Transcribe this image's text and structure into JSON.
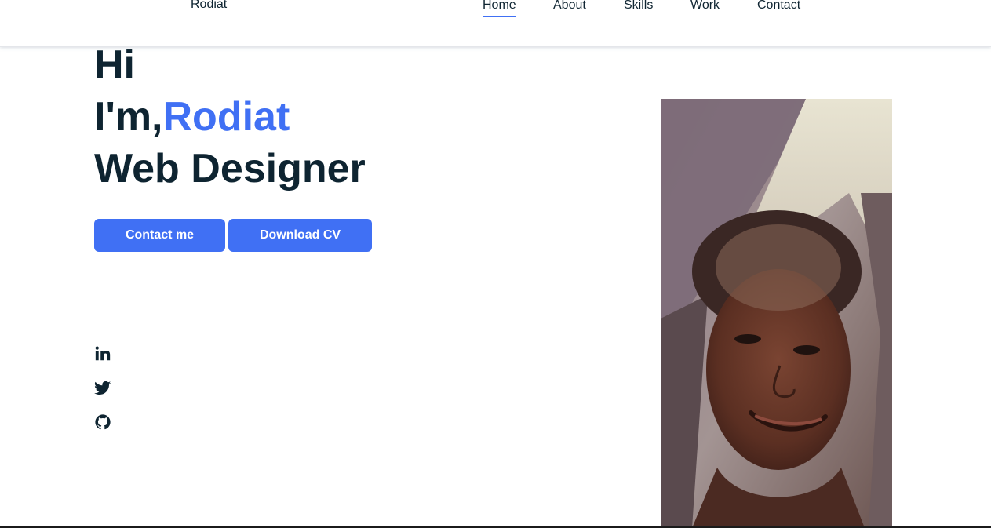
{
  "header": {
    "logo": "Rodiat",
    "nav": [
      {
        "label": "Home",
        "active": true
      },
      {
        "label": "About",
        "active": false
      },
      {
        "label": "Skills",
        "active": false
      },
      {
        "label": "Work",
        "active": false
      },
      {
        "label": "Contact",
        "active": false
      }
    ]
  },
  "hero": {
    "line1": "Hi",
    "line2_prefix": "I'm,",
    "name": "Rodiat",
    "line3": "Web Designer",
    "buttons": {
      "contact": "Contact me",
      "download_cv": "Download CV"
    }
  },
  "social": [
    {
      "icon": "linkedin-icon"
    },
    {
      "icon": "twitter-icon"
    },
    {
      "icon": "github-icon"
    }
  ],
  "colors": {
    "accent": "#4070f4",
    "text": "#0e2431",
    "background": "#ffffff"
  }
}
